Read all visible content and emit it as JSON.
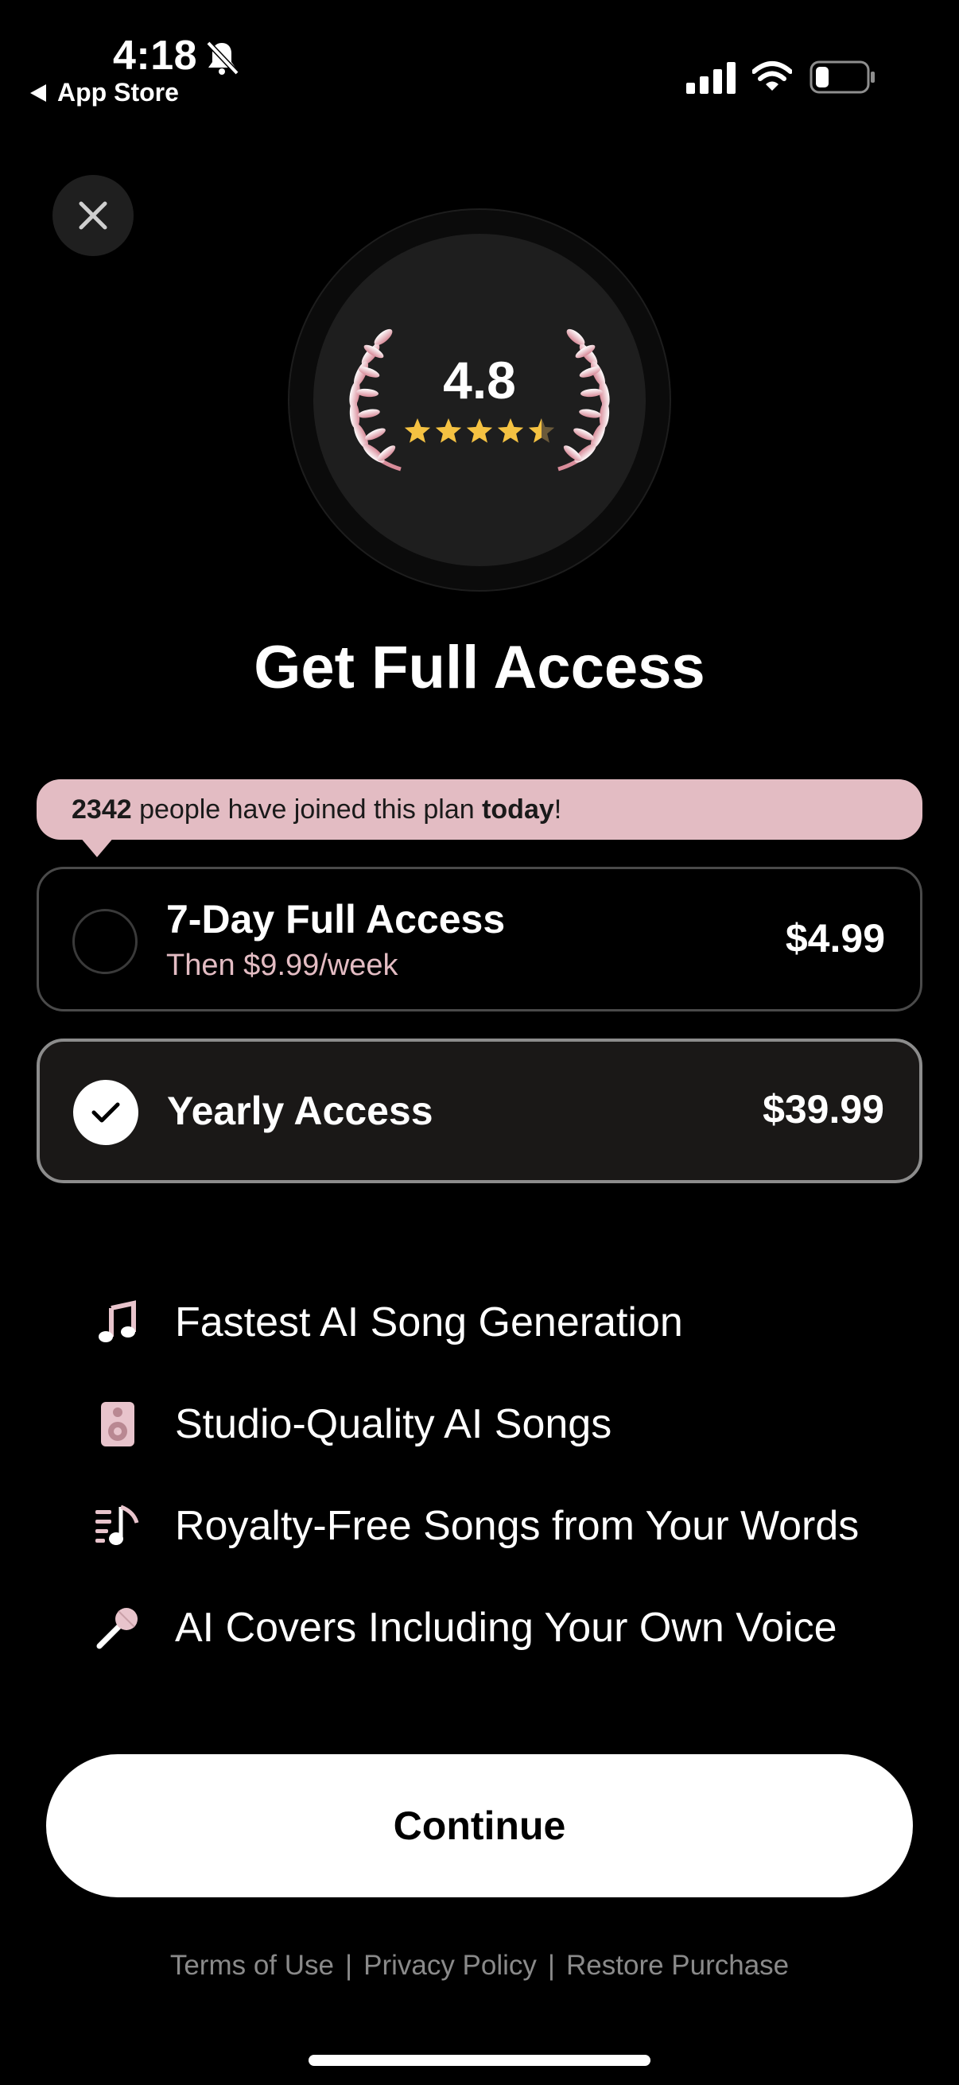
{
  "status_bar": {
    "time": "4:18",
    "back_label": "App Store"
  },
  "rating": {
    "value": "4.8",
    "stars": 4.5
  },
  "title": "Get Full Access",
  "banner": {
    "count": "2342",
    "middle": " people have joined this plan ",
    "emphasis": "today",
    "end": "!"
  },
  "plans": {
    "weekly": {
      "name": "7-Day Full Access",
      "subtitle": "Then $9.99/week",
      "price": "$4.99"
    },
    "yearly": {
      "name": "Yearly Access",
      "price": "$39.99"
    }
  },
  "features": [
    {
      "icon": "music-note-icon",
      "label": "Fastest AI Song Generation"
    },
    {
      "icon": "speaker-icon",
      "label": "Studio-Quality AI Songs"
    },
    {
      "icon": "playlist-icon",
      "label": "Royalty-Free Songs from Your Words"
    },
    {
      "icon": "microphone-icon",
      "label": "AI Covers Including Your Own Voice"
    }
  ],
  "continue_label": "Continue",
  "footer": {
    "terms": "Terms of Use",
    "privacy": "Privacy Policy",
    "restore": "Restore Purchase",
    "separator": "|"
  },
  "colors": {
    "accent_pink": "#e3bcc3",
    "star_gold": "#f5c242"
  }
}
